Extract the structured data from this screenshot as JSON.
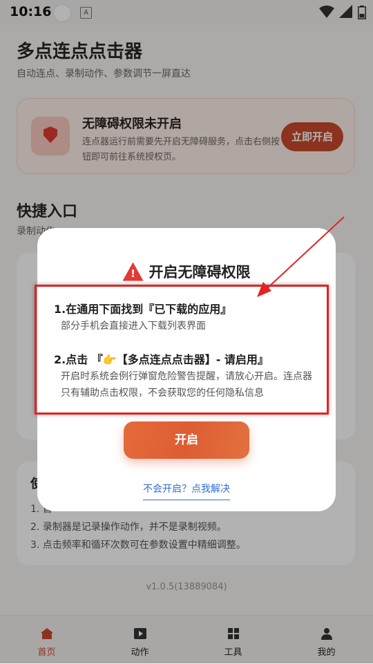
{
  "status_bar": {
    "time": "10:16",
    "keyboard_badge": "A"
  },
  "app": {
    "title": "多点连点点击器",
    "subtitle": "自动连点、录制动作、参数调节一屏直达"
  },
  "permission_card": {
    "title": "无障碍权限未开启",
    "description": "连点器运行前需要先开启无障碍服务，点击右侧按钮即可前往系统授权页。",
    "button_label": "立即开启"
  },
  "quick_entry": {
    "title": "快捷入口",
    "subtitle": "录制动作"
  },
  "tips": {
    "heading": "使",
    "items": [
      "1. 首",
      "2. 录制器是记录操作动作，并不是录制视频。",
      "3. 点击频率和循环次数可在参数设置中精细调整。"
    ]
  },
  "version": "v1.0.5(13889084)",
  "bottom_nav": [
    {
      "label": "首页",
      "icon": "home-icon",
      "active": true
    },
    {
      "label": "动作",
      "icon": "play-icon",
      "active": false
    },
    {
      "label": "工具",
      "icon": "grid-icon",
      "active": false
    },
    {
      "label": "我的",
      "icon": "person-icon",
      "active": false
    }
  ],
  "dialog": {
    "title": "开启无障碍权限",
    "icon": "warning-icon",
    "steps": [
      {
        "title": "1.在通用下面找到『已下载的应用』",
        "desc": "部分手机会直接进入下载列表界面"
      },
      {
        "title": "2.点击 『👉【多点连点点击器】- 请启用』",
        "desc": "开启时系统会例行弹窗危险警告提醒，请放心开启。连点器只有辅助点击权限，不会获取您的任何隐私信息"
      }
    ],
    "primary_button": "开启",
    "help_link": "不会开启？点我解决"
  },
  "colors": {
    "accent": "#c84a2b",
    "annotation": "#e52222",
    "link": "#2f6fd6"
  }
}
